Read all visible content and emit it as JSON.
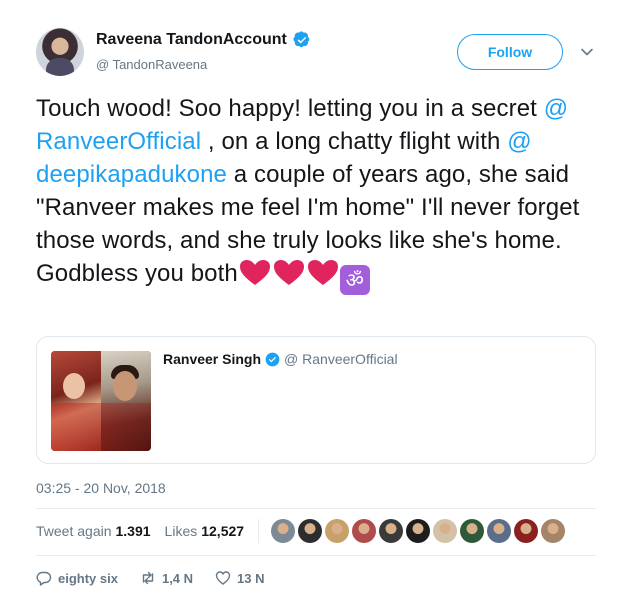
{
  "author": {
    "name": "Raveena TandonAccount",
    "handle": "@ TandonRaveena"
  },
  "follow_label": "Follow",
  "tweet": {
    "text_1": "Touch wood! Soo happy! letting you in a secret ",
    "mention_1": "@ RanveerOfficial",
    "text_2": " , on a long chatty flight with ",
    "mention_2": "@ deepikapadukone",
    "text_3": " a couple of years ago, she said \"Ranveer makes me feel I'm home\" I'll never forget those words, and she truly looks like she's home. Godbless you both",
    "emoji": [
      "heart",
      "heart",
      "heart",
      "om"
    ]
  },
  "quote": {
    "name": "Ranveer Singh",
    "handle": "@ RanveerOfficial"
  },
  "timestamp": "03:25 - 20 Nov, 2018",
  "stats": {
    "retweets_label": "Tweet again",
    "retweets_count": "1.391",
    "likes_label": "Likes",
    "likes_count": "12,527"
  },
  "likers": [
    "#7b8a96",
    "#2d2d2d",
    "#c8a06a",
    "#b14a4a",
    "#3a3a3a",
    "#1d1d1d",
    "#d4c2a8",
    "#2f5a3a",
    "#5a6e8a",
    "#8a2020",
    "#a58468"
  ],
  "actions": {
    "reply_count": "eighty six",
    "retweet_count": "1,4 N",
    "like_count": "13 N"
  },
  "colors": {
    "accent": "#1da1f2",
    "muted": "#657786",
    "heart": "#e0245e"
  }
}
